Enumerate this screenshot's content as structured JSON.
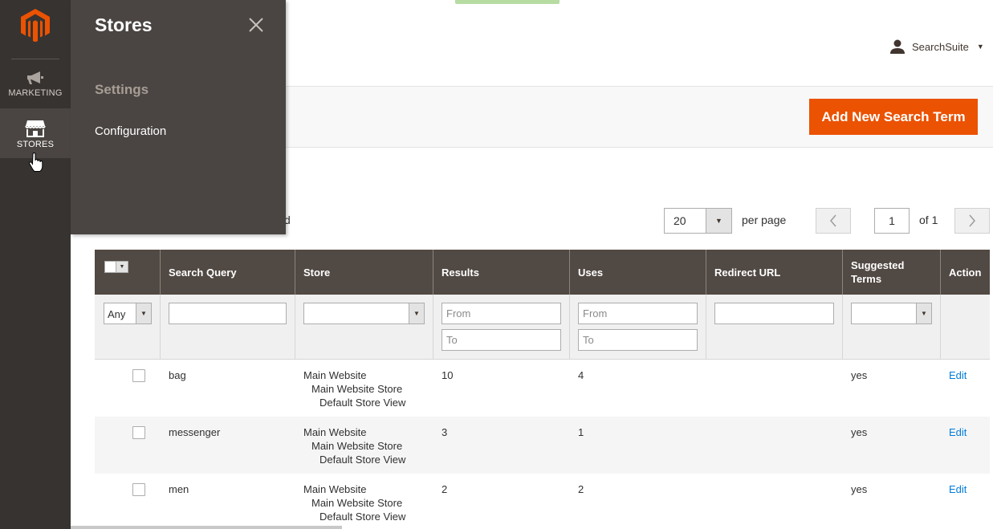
{
  "nav": {
    "items": [
      {
        "label": "MARKETING",
        "icon": "megaphone-icon"
      },
      {
        "label": "STORES",
        "icon": "storefront-icon",
        "active": true
      }
    ]
  },
  "flyout": {
    "title": "Stores",
    "group_title": "Settings",
    "links": [
      "Configuration"
    ]
  },
  "header": {
    "user_name": "SearchSuite"
  },
  "actions": {
    "add_label": "Add New Search Term"
  },
  "records_tail": "d",
  "pager": {
    "per_page_value": "20",
    "per_page_label": "per page",
    "page_value": "1",
    "of_label": "of 1"
  },
  "grid": {
    "columns": [
      "Search Query",
      "Store",
      "Results",
      "Uses",
      "Redirect URL",
      "Suggested Terms",
      "Action"
    ],
    "filters": {
      "massaction_value": "Any",
      "results_from_placeholder": "From",
      "results_to_placeholder": "To",
      "uses_from_placeholder": "From",
      "uses_to_placeholder": "To"
    },
    "rows": [
      {
        "query": "bag",
        "store_l1": "Main Website",
        "store_l2": "Main Website Store",
        "store_l3": "Default Store View",
        "results": "10",
        "uses": "4",
        "redirect": "",
        "suggested": "yes",
        "action": "Edit"
      },
      {
        "query": "messenger",
        "store_l1": "Main Website",
        "store_l2": "Main Website Store",
        "store_l3": "Default Store View",
        "results": "3",
        "uses": "1",
        "redirect": "",
        "suggested": "yes",
        "action": "Edit"
      },
      {
        "query": "men",
        "store_l1": "Main Website",
        "store_l2": "Main Website Store",
        "store_l3": "Default Store View",
        "results": "2",
        "uses": "2",
        "redirect": "",
        "suggested": "yes",
        "action": "Edit"
      }
    ]
  },
  "colors": {
    "accent": "#eb5202",
    "rail": "#373330",
    "flyout": "#4a4542",
    "grid_header": "#514943",
    "link": "#007bdb"
  }
}
